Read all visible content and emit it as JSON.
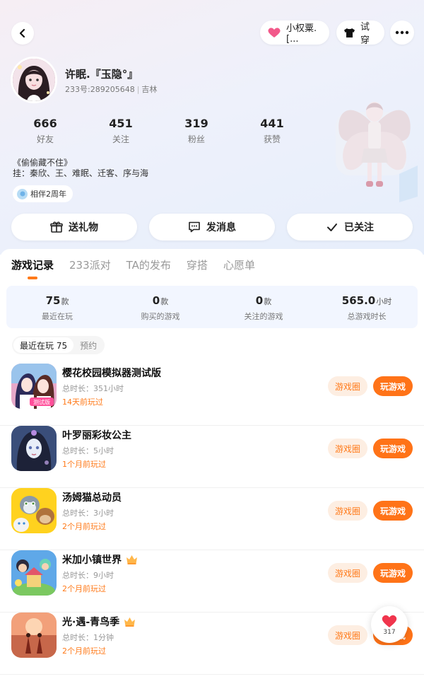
{
  "header": {
    "back_icon": "chevron-left-icon",
    "intimacy": {
      "label": "小权粟.[...",
      "icon": "heart-icon"
    },
    "try_on": {
      "label": "试穿",
      "icon": "tshirt-icon"
    },
    "more_icon": "more-dots-icon"
  },
  "profile": {
    "name": "许眠.『玉隐°』",
    "id_text": "233号:289205648",
    "location": "吉林",
    "stats": [
      {
        "value": "666",
        "label": "好友"
      },
      {
        "value": "451",
        "label": "关注"
      },
      {
        "value": "319",
        "label": "粉丝"
      },
      {
        "value": "441",
        "label": "获赞"
      }
    ],
    "bio_line1": "《偷偷藏不住》",
    "bio_line2": "挂：秦欣、王、难眠、迁客、序与海",
    "anniversary": "相伴2周年"
  },
  "actions": {
    "gift": "送礼物",
    "message": "发消息",
    "followed": "已关注"
  },
  "tabs": [
    "游戏记录",
    "233派对",
    "TA的发布",
    "穿搭",
    "心愿单"
  ],
  "summary": [
    {
      "value": "75",
      "unit": "款",
      "label": "最近在玩"
    },
    {
      "value": "0",
      "unit": "款",
      "label": "购买的游戏"
    },
    {
      "value": "0",
      "unit": "款",
      "label": "关注的游戏"
    },
    {
      "value": "565.0",
      "unit": "小时",
      "label": "总游戏时长"
    }
  ],
  "subtabs": {
    "recent": "最近在玩 75",
    "reserve": "预约"
  },
  "games": [
    {
      "name": "樱花校园模拟器测试版",
      "duration": "总时长：351小时",
      "last_played": "14天前玩过",
      "crown": false,
      "circle_label": "游戏圈",
      "play_label": "玩游戏",
      "icon_badge": "测试版"
    },
    {
      "name": "叶罗丽彩妆公主",
      "duration": "总时长：5小时",
      "last_played": "1个月前玩过",
      "crown": false,
      "circle_label": "游戏圈",
      "play_label": "玩游戏"
    },
    {
      "name": "汤姆猫总动员",
      "duration": "总时长：3小时",
      "last_played": "2个月前玩过",
      "crown": false,
      "circle_label": "游戏圈",
      "play_label": "玩游戏"
    },
    {
      "name": "米加小镇世界",
      "duration": "总时长：9小时",
      "last_played": "2个月前玩过",
      "crown": true,
      "circle_label": "游戏圈",
      "play_label": "玩游戏"
    },
    {
      "name": "光·遇-青鸟季",
      "duration": "总时长：1分钟",
      "last_played": "2个月前玩过",
      "crown": true,
      "circle_label": "游戏圈",
      "play_label": "玩游戏"
    }
  ],
  "floating_like": {
    "count": "317",
    "icon": "heart-icon"
  },
  "colors": {
    "accent": "#ff7318",
    "accent_soft": "#fdeee2",
    "summary_bg": "#f2f6ff"
  }
}
